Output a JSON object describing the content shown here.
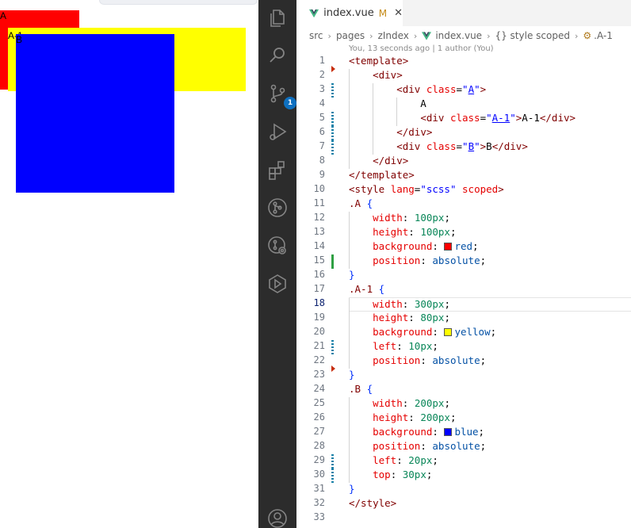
{
  "preview": {
    "box_a_text": "A",
    "box_a1_text": "A-1",
    "box_b_text": "B",
    "colors": {
      "a": "#ff0000",
      "a1": "#ffff00",
      "b": "#0000ff"
    }
  },
  "activity_bar": {
    "items": [
      {
        "name": "explorer-icon"
      },
      {
        "name": "search-icon"
      },
      {
        "name": "source-control-icon",
        "badge": "1"
      },
      {
        "name": "run-debug-icon"
      },
      {
        "name": "extensions-icon"
      },
      {
        "name": "git-graph-icon"
      },
      {
        "name": "remote-icon"
      },
      {
        "name": "live-share-icon"
      },
      {
        "name": "account-icon"
      }
    ]
  },
  "editor": {
    "tab": {
      "label": "index.vue",
      "status": "M",
      "close": "✕"
    },
    "breadcrumb": {
      "items": [
        "src",
        "pages",
        "zIndex",
        "index.vue",
        "{} style scoped",
        ".A-1"
      ],
      "separator": "›"
    },
    "blame": "You, 13 seconds ago | 1 author (You)",
    "active_line": 18,
    "lines": [
      "1",
      "2",
      "3",
      "4",
      "5",
      "6",
      "7",
      "8",
      "9",
      "10",
      "11",
      "12",
      "13",
      "14",
      "15",
      "16",
      "17",
      "18",
      "19",
      "20",
      "21",
      "22",
      "23",
      "24",
      "25",
      "26",
      "27",
      "28",
      "29",
      "30",
      "31",
      "32",
      "33"
    ]
  }
}
